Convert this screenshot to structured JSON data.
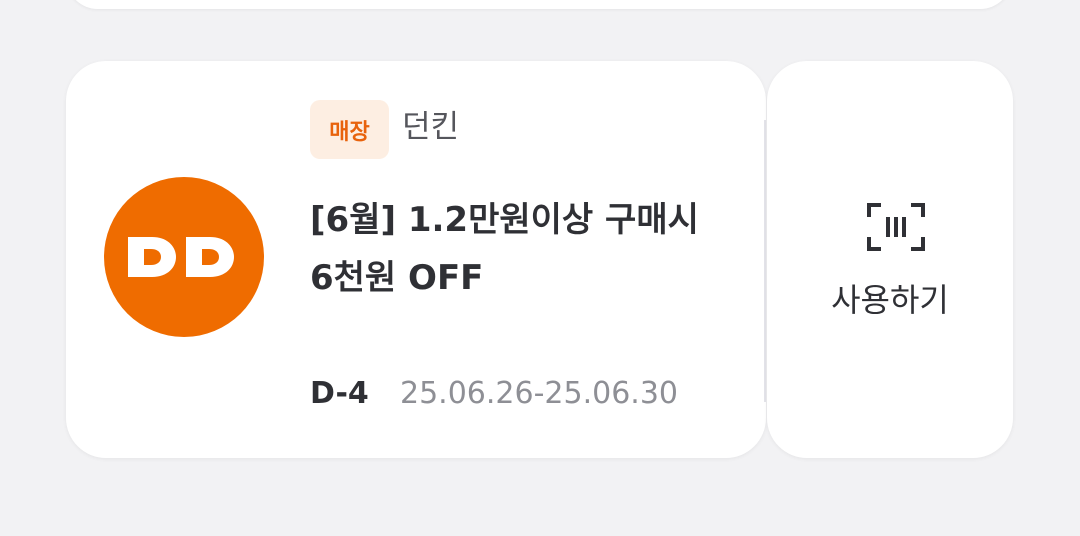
{
  "coupon": {
    "logo_text": "DD",
    "logo_color": "#ef6c00",
    "badge_label": "매장",
    "brand_name": "던킨",
    "title": "[6월] 1.2만원이상 구매시 6천원 OFF",
    "d_day": "D-4",
    "period": "25.06.26-25.06.30",
    "action_icon": "barcode-scan-icon",
    "action_label": "사용하기"
  }
}
